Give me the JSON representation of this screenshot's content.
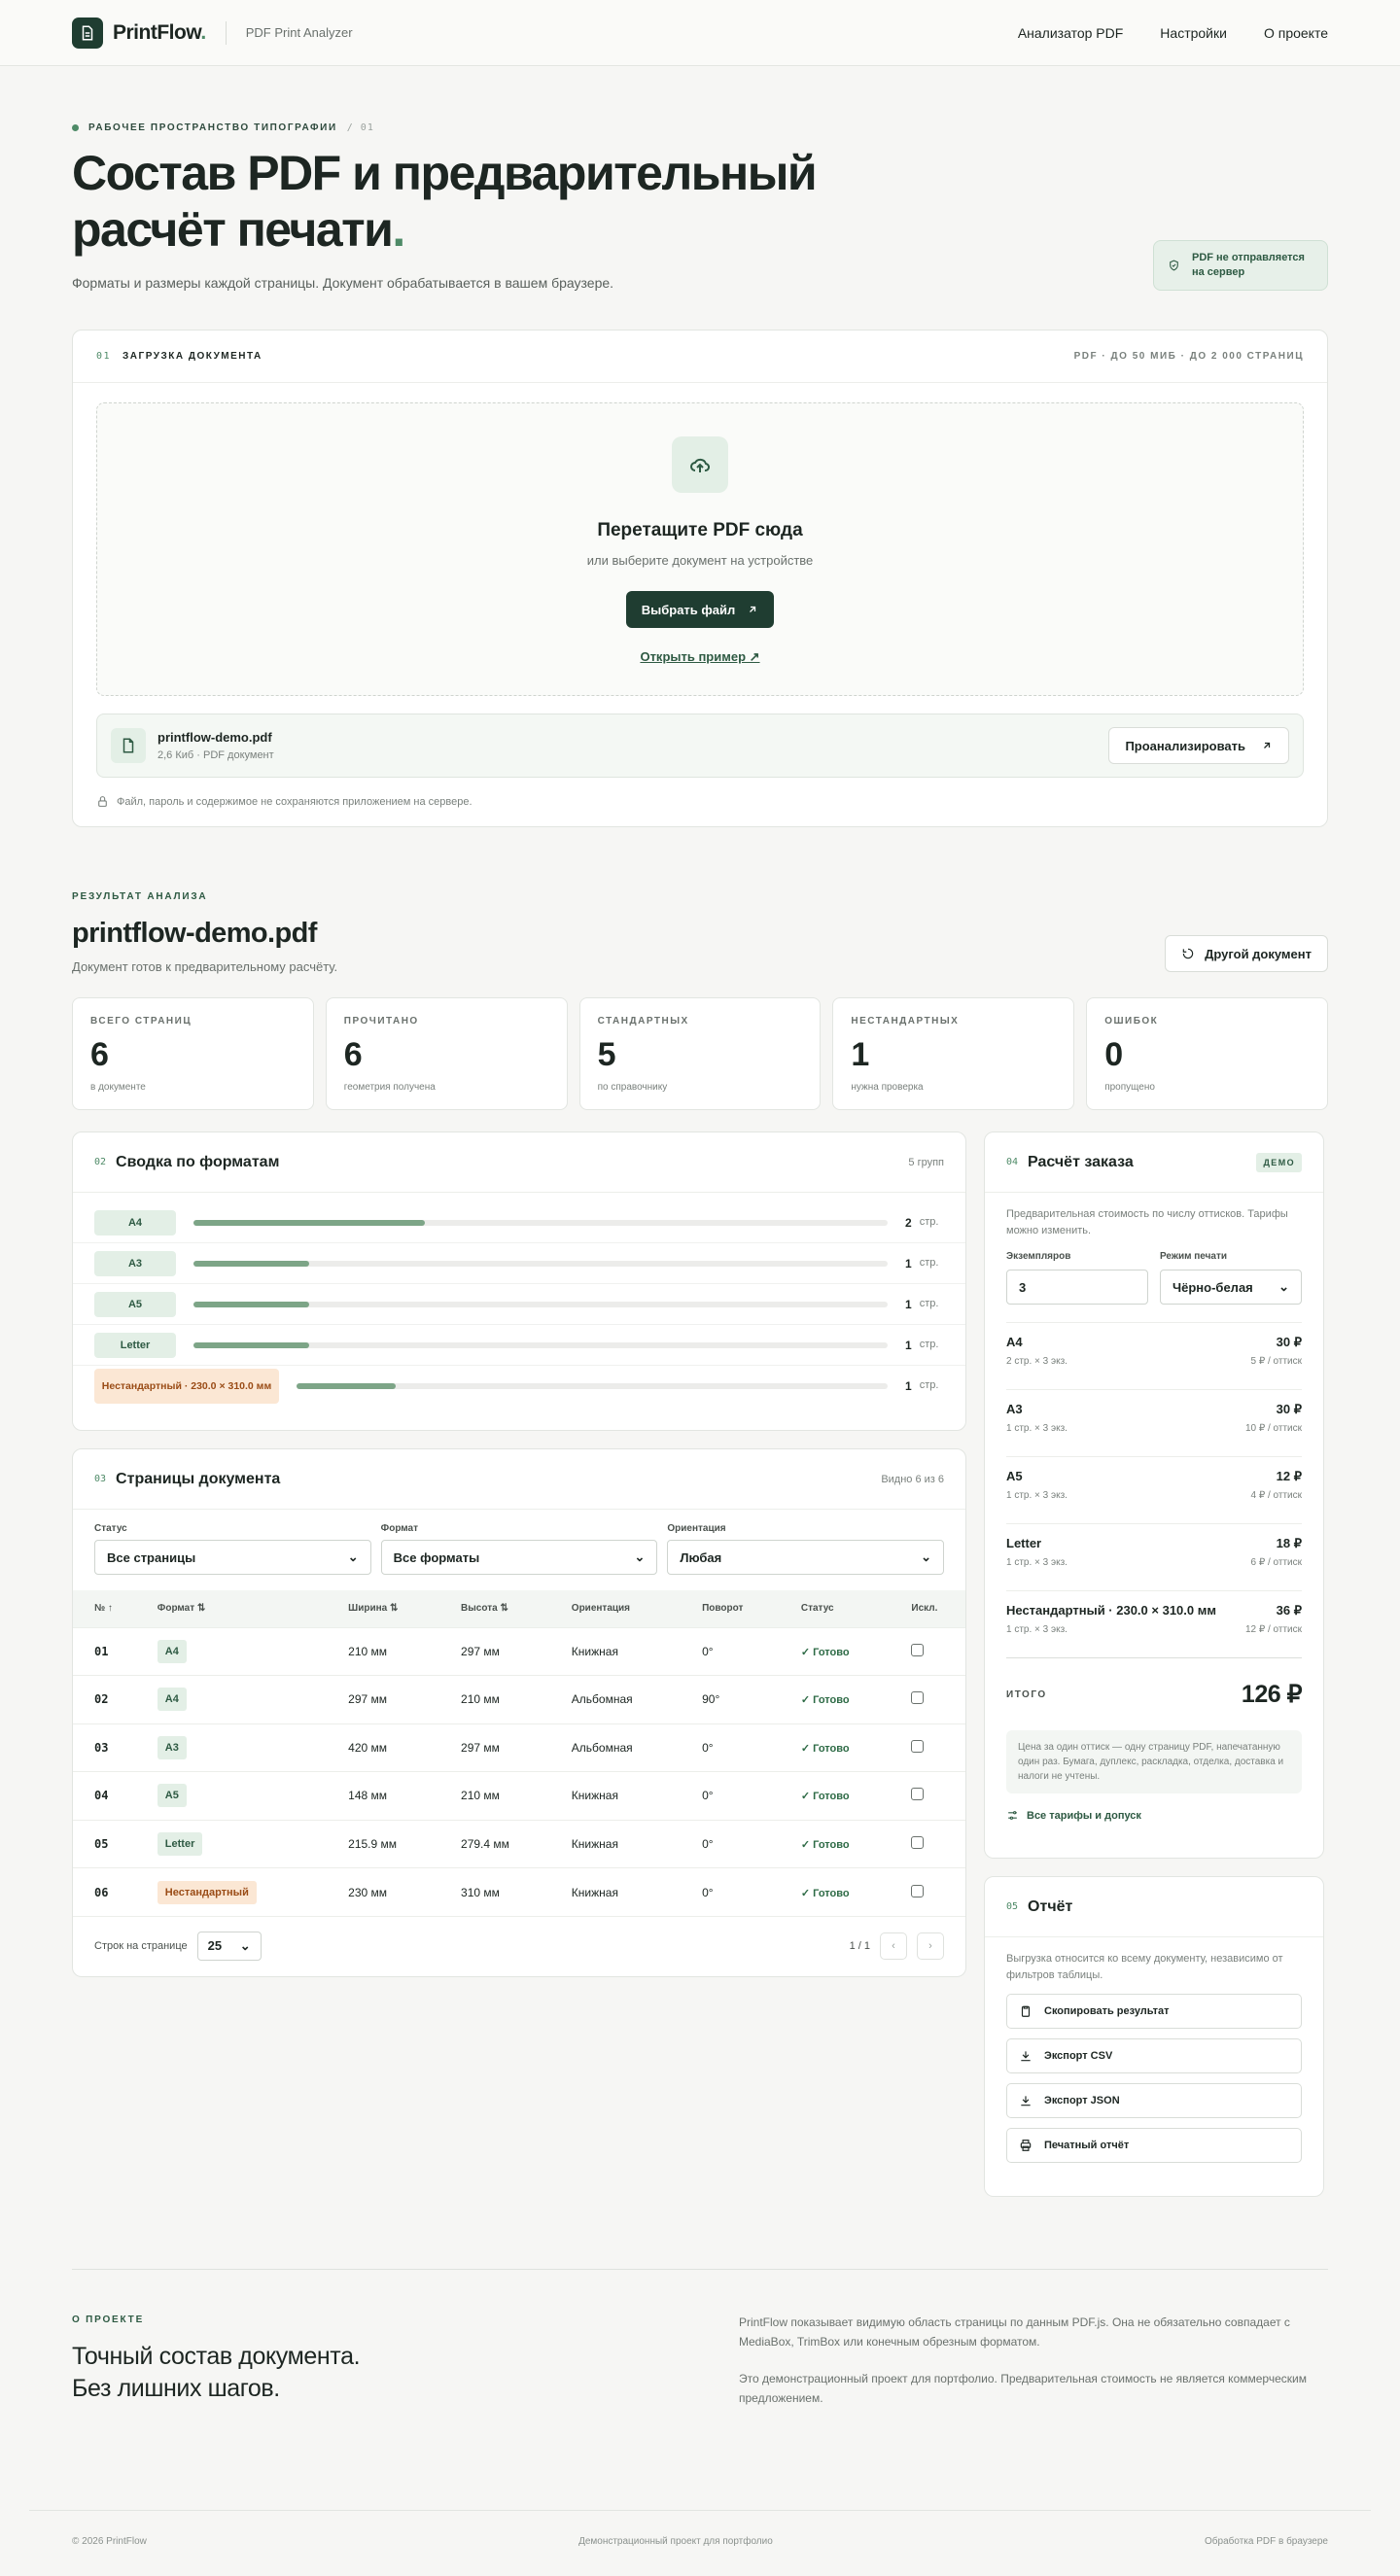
{
  "header": {
    "logo": "PrintFlow",
    "logo_dot": ".",
    "tagline": "PDF Print Analyzer",
    "nav": [
      "Анализатор PDF",
      "Настройки",
      "О проекте"
    ]
  },
  "hero": {
    "eyebrow": "РАБОЧЕЕ ПРОСТРАНСТВО ТИПОГРАФИИ",
    "eyebrow_num": "/ 01",
    "title": "Состав PDF и предварительный расчёт печати",
    "title_dot": ".",
    "subtitle": "Форматы и размеры каждой страницы. Документ обрабатывается в вашем браузере.",
    "privacy": "PDF не отправляется на сервер"
  },
  "upload": {
    "num": "01",
    "title": "ЗАГРУЗКА ДОКУМЕНТА",
    "limits": "PDF · ДО 50 МИБ · ДО 2 000 СТРАНИЦ",
    "drop_title": "Перетащите PDF сюда",
    "drop_sub": "или выберите документ на устройстве",
    "choose": "Выбрать файл",
    "sample": "Открыть пример ↗",
    "file_name": "printflow-demo.pdf",
    "file_meta": "2,6 Киб · PDF документ",
    "analyze": "Проанализировать",
    "note": "Файл, пароль и содержимое не сохраняются приложением на сервере."
  },
  "result": {
    "eyebrow": "РЕЗУЛЬТАТ АНАЛИЗА",
    "title": "printflow-demo.pdf",
    "subtitle": "Документ готов к предварительному расчёту.",
    "other": "Другой документ"
  },
  "stats": [
    {
      "label": "ВСЕГО СТРАНИЦ",
      "value": "6",
      "sub": "в документе"
    },
    {
      "label": "ПРОЧИТАНО",
      "value": "6",
      "sub": "геометрия получена"
    },
    {
      "label": "СТАНДАРТНЫХ",
      "value": "5",
      "sub": "по справочнику"
    },
    {
      "label": "НЕСТАНДАРТНЫХ",
      "value": "1",
      "sub": "нужна проверка"
    },
    {
      "label": "ОШИБОК",
      "value": "0",
      "sub": "пропущено"
    }
  ],
  "formats": {
    "num": "02",
    "title": "Сводка по форматам",
    "groups": "5 групп",
    "unit": "стр.",
    "rows": [
      {
        "name": "A4",
        "count": "2",
        "share": 0.333,
        "ns": false
      },
      {
        "name": "A3",
        "count": "1",
        "share": 0.167,
        "ns": false
      },
      {
        "name": "A5",
        "count": "1",
        "share": 0.167,
        "ns": false
      },
      {
        "name": "Letter",
        "count": "1",
        "share": 0.167,
        "ns": false
      },
      {
        "name": "Нестандартный · 230.0 × 310.0 мм",
        "count": "1",
        "share": 0.167,
        "ns": true
      }
    ]
  },
  "pages": {
    "num": "03",
    "title": "Страницы документа",
    "visible": "Видно 6 из 6",
    "filters": [
      {
        "label": "Статус",
        "value": "Все страницы"
      },
      {
        "label": "Формат",
        "value": "Все форматы"
      },
      {
        "label": "Ориентация",
        "value": "Любая"
      }
    ],
    "columns": [
      "№ ↑",
      "Формат ⇅",
      "Ширина ⇅",
      "Высота ⇅",
      "Ориентация",
      "Поворот",
      "Статус",
      "Искл."
    ],
    "rows": [
      {
        "no": "01",
        "fmt": "A4",
        "w": "210 мм",
        "h": "297 мм",
        "o": "Книжная",
        "r": "0°",
        "s": "Готово",
        "ns": false
      },
      {
        "no": "02",
        "fmt": "A4",
        "w": "297 мм",
        "h": "210 мм",
        "o": "Альбомная",
        "r": "90°",
        "s": "Готово",
        "ns": false
      },
      {
        "no": "03",
        "fmt": "A3",
        "w": "420 мм",
        "h": "297 мм",
        "o": "Альбомная",
        "r": "0°",
        "s": "Готово",
        "ns": false
      },
      {
        "no": "04",
        "fmt": "A5",
        "w": "148 мм",
        "h": "210 мм",
        "o": "Книжная",
        "r": "0°",
        "s": "Готово",
        "ns": false
      },
      {
        "no": "05",
        "fmt": "Letter",
        "w": "215.9 мм",
        "h": "279.4 мм",
        "o": "Книжная",
        "r": "0°",
        "s": "Готово",
        "ns": false
      },
      {
        "no": "06",
        "fmt": "Нестандартный",
        "w": "230 мм",
        "h": "310 мм",
        "o": "Книжная",
        "r": "0°",
        "s": "Готово",
        "ns": true
      }
    ],
    "per_page_label": "Строк на странице",
    "per_page": "25",
    "page_info": "1 / 1"
  },
  "calc": {
    "num": "04",
    "title": "Расчёт заказа",
    "badge": "ДЕМО",
    "desc": "Предварительная стоимость по числу оттисков. Тарифы можно изменить.",
    "copies_label": "Экземпляров",
    "copies": "3",
    "mode_label": "Режим печати",
    "mode": "Чёрно-белая",
    "lines": [
      {
        "name": "A4",
        "sub": "2 стр. × 3 экз.",
        "price": "30 ₽",
        "rate": "5 ₽ / оттиск"
      },
      {
        "name": "A3",
        "sub": "1 стр. × 3 экз.",
        "price": "30 ₽",
        "rate": "10 ₽ / оттиск"
      },
      {
        "name": "A5",
        "sub": "1 стр. × 3 экз.",
        "price": "12 ₽",
        "rate": "4 ₽ / оттиск"
      },
      {
        "name": "Letter",
        "sub": "1 стр. × 3 экз.",
        "price": "18 ₽",
        "rate": "6 ₽ / оттиск"
      },
      {
        "name": "Нестандартный · 230.0 × 310.0 мм",
        "sub": "1 стр. × 3 экз.",
        "price": "36 ₽",
        "rate": "12 ₽ / оттиск"
      }
    ],
    "total_label": "ИТОГО",
    "total": "126 ₽",
    "hint": "Цена за один оттиск — одну страницу PDF, напечатанную один раз. Бумага, дуплекс, раскладка, отделка, доставка и налоги не учтены.",
    "tariffs": "Все тарифы и допуск"
  },
  "report": {
    "num": "05",
    "title": "Отчёт",
    "desc": "Выгрузка относится ко всему документу, независимо от фильтров таблицы.",
    "buttons": [
      "Скопировать результат",
      "Экспорт CSV",
      "Экспорт JSON",
      "Печатный отчёт"
    ]
  },
  "about": {
    "eyebrow": "О ПРОЕКТЕ",
    "title1": "Точный состав документа.",
    "title2": "Без лишних шагов.",
    "p1": "PrintFlow показывает видимую область страницы по данным PDF.js. Она не обязательно совпадает с MediaBox, TrimBox или конечным обрезным форматом.",
    "p2": "Это демонстрационный проект для портфолио. Предварительная стоимость не является коммерческим предложением."
  },
  "footer": {
    "left": "© 2026 PrintFlow",
    "center": "Демонстрационный проект для портфолио",
    "right": "Обработка PDF в браузере"
  }
}
